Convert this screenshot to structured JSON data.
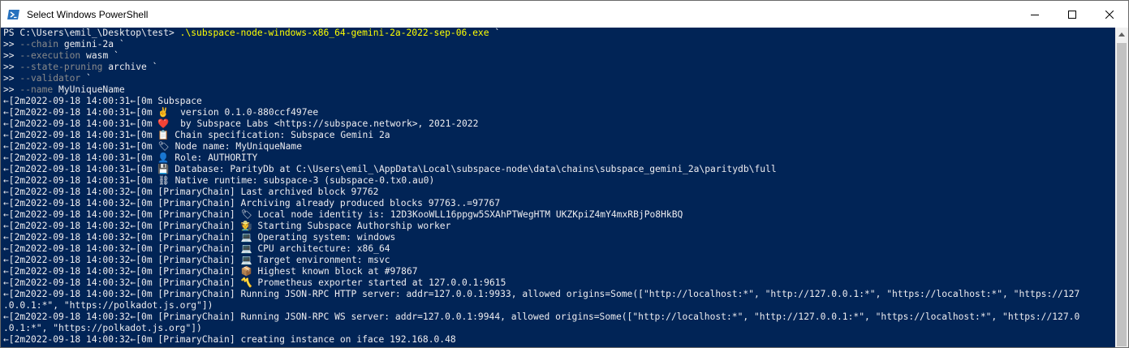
{
  "window": {
    "title": "Select Windows PowerShell",
    "icons": {
      "app": "powershell-icon",
      "minimize": "minimize-icon",
      "maximize": "maximize-icon",
      "close": "close-icon",
      "scroll_up": "chevron-up-icon"
    },
    "colors": {
      "console_bg": "#012456",
      "text": "#eeedf0",
      "param": "#8a8a8a",
      "command": "#ffff00"
    }
  },
  "console": {
    "lines": [
      [
        {
          "t": "PS C:\\Users\\emil_\\Desktop\\test> ",
          "c": "white"
        },
        {
          "t": ".\\subspace-node-windows-x86_64-gemini-2a-2022-sep-06.exe",
          "c": "yellow"
        },
        {
          "t": " `",
          "c": "white"
        }
      ],
      [
        {
          "t": ">> ",
          "c": "white"
        },
        {
          "t": "--chain",
          "c": "gray"
        },
        {
          "t": " gemini-2a `",
          "c": "white"
        }
      ],
      [
        {
          "t": ">> ",
          "c": "white"
        },
        {
          "t": "--execution",
          "c": "gray"
        },
        {
          "t": " wasm `",
          "c": "white"
        }
      ],
      [
        {
          "t": ">> ",
          "c": "white"
        },
        {
          "t": "--state-pruning",
          "c": "gray"
        },
        {
          "t": " archive `",
          "c": "white"
        }
      ],
      [
        {
          "t": ">> ",
          "c": "white"
        },
        {
          "t": "--validator",
          "c": "gray"
        },
        {
          "t": " `",
          "c": "white"
        }
      ],
      [
        {
          "t": ">> ",
          "c": "white"
        },
        {
          "t": "--name",
          "c": "gray"
        },
        {
          "t": " MyUniqueName",
          "c": "white"
        }
      ],
      [
        {
          "t": "←[2m2022-09-18 14:00:31←[0m Subspace",
          "c": "white"
        }
      ],
      [
        {
          "t": "←[2m2022-09-18 14:00:31←[0m ✌️  version 0.1.0-880ccf497ee",
          "c": "white"
        }
      ],
      [
        {
          "t": "←[2m2022-09-18 14:00:31←[0m ❤️  by Subspace Labs <https://subspace.network>, 2021-2022",
          "c": "white"
        }
      ],
      [
        {
          "t": "←[2m2022-09-18 14:00:31←[0m 📋 Chain specification: Subspace Gemini 2a",
          "c": "white"
        }
      ],
      [
        {
          "t": "←[2m2022-09-18 14:00:31←[0m 🏷 Node name: MyUniqueName",
          "c": "white"
        }
      ],
      [
        {
          "t": "←[2m2022-09-18 14:00:31←[0m 👤 Role: AUTHORITY",
          "c": "white"
        }
      ],
      [
        {
          "t": "←[2m2022-09-18 14:00:31←[0m 💾 Database: ParityDb at C:\\Users\\emil_\\AppData\\Local\\subspace-node\\data\\chains\\subspace_gemini_2a\\paritydb\\full",
          "c": "white"
        }
      ],
      [
        {
          "t": "←[2m2022-09-18 14:00:31←[0m ⛓ Native runtime: subspace-3 (subspace-0.tx0.au0)",
          "c": "white"
        }
      ],
      [
        {
          "t": "←[2m2022-09-18 14:00:32←[0m [PrimaryChain] Last archived block 97762",
          "c": "white"
        }
      ],
      [
        {
          "t": "←[2m2022-09-18 14:00:32←[0m [PrimaryChain] Archiving already produced blocks 97763..=97767",
          "c": "white"
        }
      ],
      [
        {
          "t": "←[2m2022-09-18 14:00:32←[0m [PrimaryChain] 🏷 Local node identity is: 12D3KooWLL16ppgw5SXAhPTWegHTM UKZKpiZ4mY4mxRBjPo8HkBQ",
          "c": "white"
        }
      ],
      [
        {
          "t": "←[2m2022-09-18 14:00:32←[0m [PrimaryChain] 🧑‍🌾 Starting Subspace Authorship worker",
          "c": "white"
        }
      ],
      [
        {
          "t": "←[2m2022-09-18 14:00:32←[0m [PrimaryChain] 💻 Operating system: windows",
          "c": "white"
        }
      ],
      [
        {
          "t": "←[2m2022-09-18 14:00:32←[0m [PrimaryChain] 💻 CPU architecture: x86_64",
          "c": "white"
        }
      ],
      [
        {
          "t": "←[2m2022-09-18 14:00:32←[0m [PrimaryChain] 💻 Target environment: msvc",
          "c": "white"
        }
      ],
      [
        {
          "t": "←[2m2022-09-18 14:00:32←[0m [PrimaryChain] 📦 Highest known block at #97867",
          "c": "white"
        }
      ],
      [
        {
          "t": "←[2m2022-09-18 14:00:32←[0m [PrimaryChain] 〽️ Prometheus exporter started at 127.0.0.1:9615",
          "c": "white"
        }
      ],
      [
        {
          "t": "←[2m2022-09-18 14:00:32←[0m [PrimaryChain] Running JSON-RPC HTTP server: addr=127.0.0.1:9933, allowed origins=Some([\"http://localhost:*\", \"http://127.0.0.1:*\", \"https://localhost:*\", \"https://127",
          "c": "white"
        }
      ],
      [
        {
          "t": ".0.0.1:*\", \"https://polkadot.js.org\"])",
          "c": "white"
        }
      ],
      [
        {
          "t": "←[2m2022-09-18 14:00:32←[0m [PrimaryChain] Running JSON-RPC WS server: addr=127.0.0.1:9944, allowed origins=Some([\"http://localhost:*\", \"http://127.0.0.1:*\", \"https://localhost:*\", \"https://127.0",
          "c": "white"
        }
      ],
      [
        {
          "t": ".0.1:*\", \"https://polkadot.js.org\"])",
          "c": "white"
        }
      ],
      [
        {
          "t": "←[2m2022-09-18 14:00:32←[0m [PrimaryChain] creating instance on iface 192.168.0.48",
          "c": "white"
        }
      ]
    ]
  }
}
